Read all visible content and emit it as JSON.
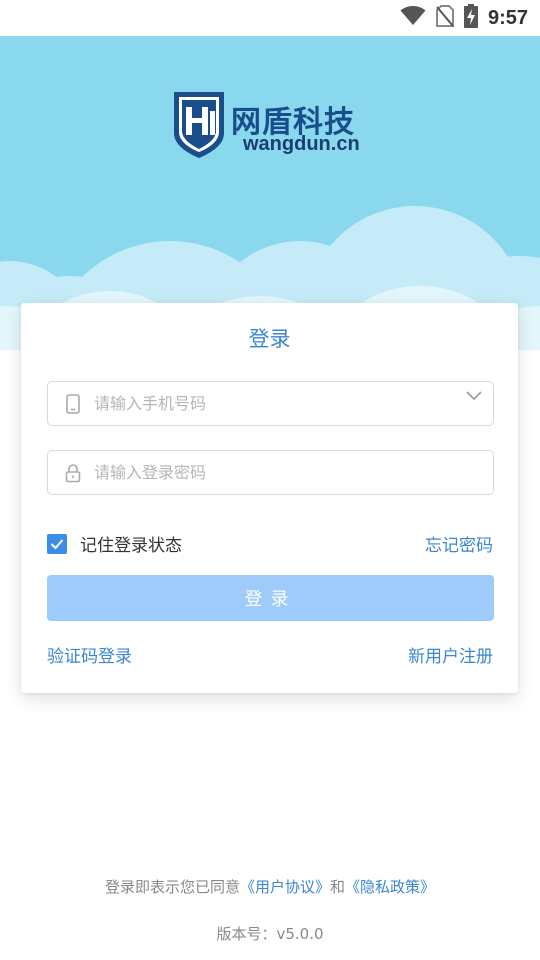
{
  "status_bar": {
    "time": "9:57",
    "icons": [
      "wifi-icon",
      "no-sim-icon",
      "battery-charging-icon"
    ]
  },
  "brand": {
    "name_cn": "网盾科技",
    "name_en": "wangdun.cn",
    "logo_letters": "HI",
    "colors": {
      "hero_bg": "#8ad8ee",
      "logo_blue": "#1a4d8c",
      "accent": "#3a86d0"
    }
  },
  "login_card": {
    "title": "登录",
    "phone_field": {
      "placeholder": "请输入手机号码",
      "value": "",
      "icon": "phone-icon",
      "dropdown_icon": "chevron-down-icon"
    },
    "password_field": {
      "placeholder": "请输入登录密码",
      "value": "",
      "icon": "lock-icon"
    },
    "remember": {
      "label": "记住登录状态",
      "checked": true
    },
    "forgot_password": "忘记密码",
    "login_button": "登录",
    "sms_login": "验证码登录",
    "register": "新用户注册"
  },
  "footer": {
    "agreement_prefix": "登录即表示您已同意",
    "user_agreement": "《用户协议》",
    "and": "和",
    "privacy_policy": "《隐私政策》",
    "version": "版本号：v5.0.0"
  }
}
